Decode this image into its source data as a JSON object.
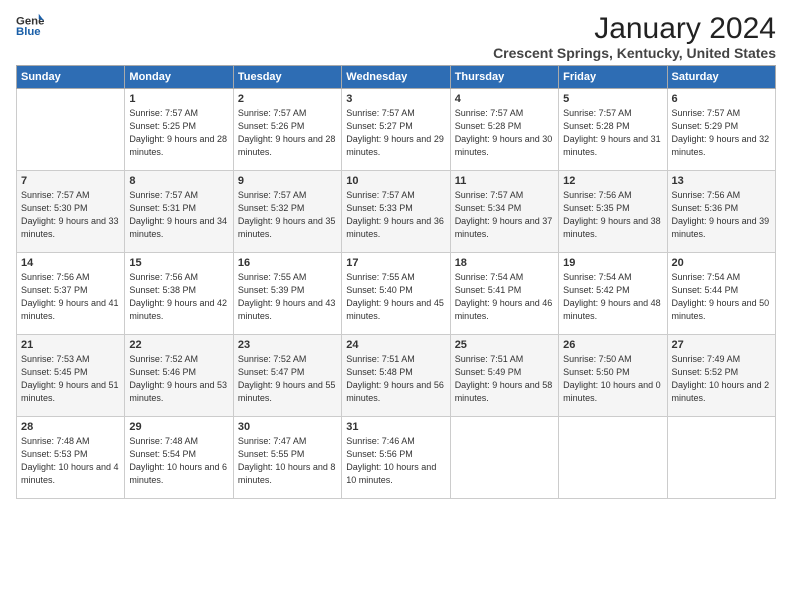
{
  "logo": {
    "line1": "General",
    "line2": "Blue"
  },
  "title": "January 2024",
  "location": "Crescent Springs, Kentucky, United States",
  "days_of_week": [
    "Sunday",
    "Monday",
    "Tuesday",
    "Wednesday",
    "Thursday",
    "Friday",
    "Saturday"
  ],
  "weeks": [
    [
      {
        "day": "",
        "sunrise": "",
        "sunset": "",
        "daylight": ""
      },
      {
        "day": "1",
        "sunrise": "Sunrise: 7:57 AM",
        "sunset": "Sunset: 5:25 PM",
        "daylight": "Daylight: 9 hours and 28 minutes."
      },
      {
        "day": "2",
        "sunrise": "Sunrise: 7:57 AM",
        "sunset": "Sunset: 5:26 PM",
        "daylight": "Daylight: 9 hours and 28 minutes."
      },
      {
        "day": "3",
        "sunrise": "Sunrise: 7:57 AM",
        "sunset": "Sunset: 5:27 PM",
        "daylight": "Daylight: 9 hours and 29 minutes."
      },
      {
        "day": "4",
        "sunrise": "Sunrise: 7:57 AM",
        "sunset": "Sunset: 5:28 PM",
        "daylight": "Daylight: 9 hours and 30 minutes."
      },
      {
        "day": "5",
        "sunrise": "Sunrise: 7:57 AM",
        "sunset": "Sunset: 5:28 PM",
        "daylight": "Daylight: 9 hours and 31 minutes."
      },
      {
        "day": "6",
        "sunrise": "Sunrise: 7:57 AM",
        "sunset": "Sunset: 5:29 PM",
        "daylight": "Daylight: 9 hours and 32 minutes."
      }
    ],
    [
      {
        "day": "7",
        "sunrise": "Sunrise: 7:57 AM",
        "sunset": "Sunset: 5:30 PM",
        "daylight": "Daylight: 9 hours and 33 minutes."
      },
      {
        "day": "8",
        "sunrise": "Sunrise: 7:57 AM",
        "sunset": "Sunset: 5:31 PM",
        "daylight": "Daylight: 9 hours and 34 minutes."
      },
      {
        "day": "9",
        "sunrise": "Sunrise: 7:57 AM",
        "sunset": "Sunset: 5:32 PM",
        "daylight": "Daylight: 9 hours and 35 minutes."
      },
      {
        "day": "10",
        "sunrise": "Sunrise: 7:57 AM",
        "sunset": "Sunset: 5:33 PM",
        "daylight": "Daylight: 9 hours and 36 minutes."
      },
      {
        "day": "11",
        "sunrise": "Sunrise: 7:57 AM",
        "sunset": "Sunset: 5:34 PM",
        "daylight": "Daylight: 9 hours and 37 minutes."
      },
      {
        "day": "12",
        "sunrise": "Sunrise: 7:56 AM",
        "sunset": "Sunset: 5:35 PM",
        "daylight": "Daylight: 9 hours and 38 minutes."
      },
      {
        "day": "13",
        "sunrise": "Sunrise: 7:56 AM",
        "sunset": "Sunset: 5:36 PM",
        "daylight": "Daylight: 9 hours and 39 minutes."
      }
    ],
    [
      {
        "day": "14",
        "sunrise": "Sunrise: 7:56 AM",
        "sunset": "Sunset: 5:37 PM",
        "daylight": "Daylight: 9 hours and 41 minutes."
      },
      {
        "day": "15",
        "sunrise": "Sunrise: 7:56 AM",
        "sunset": "Sunset: 5:38 PM",
        "daylight": "Daylight: 9 hours and 42 minutes."
      },
      {
        "day": "16",
        "sunrise": "Sunrise: 7:55 AM",
        "sunset": "Sunset: 5:39 PM",
        "daylight": "Daylight: 9 hours and 43 minutes."
      },
      {
        "day": "17",
        "sunrise": "Sunrise: 7:55 AM",
        "sunset": "Sunset: 5:40 PM",
        "daylight": "Daylight: 9 hours and 45 minutes."
      },
      {
        "day": "18",
        "sunrise": "Sunrise: 7:54 AM",
        "sunset": "Sunset: 5:41 PM",
        "daylight": "Daylight: 9 hours and 46 minutes."
      },
      {
        "day": "19",
        "sunrise": "Sunrise: 7:54 AM",
        "sunset": "Sunset: 5:42 PM",
        "daylight": "Daylight: 9 hours and 48 minutes."
      },
      {
        "day": "20",
        "sunrise": "Sunrise: 7:54 AM",
        "sunset": "Sunset: 5:44 PM",
        "daylight": "Daylight: 9 hours and 50 minutes."
      }
    ],
    [
      {
        "day": "21",
        "sunrise": "Sunrise: 7:53 AM",
        "sunset": "Sunset: 5:45 PM",
        "daylight": "Daylight: 9 hours and 51 minutes."
      },
      {
        "day": "22",
        "sunrise": "Sunrise: 7:52 AM",
        "sunset": "Sunset: 5:46 PM",
        "daylight": "Daylight: 9 hours and 53 minutes."
      },
      {
        "day": "23",
        "sunrise": "Sunrise: 7:52 AM",
        "sunset": "Sunset: 5:47 PM",
        "daylight": "Daylight: 9 hours and 55 minutes."
      },
      {
        "day": "24",
        "sunrise": "Sunrise: 7:51 AM",
        "sunset": "Sunset: 5:48 PM",
        "daylight": "Daylight: 9 hours and 56 minutes."
      },
      {
        "day": "25",
        "sunrise": "Sunrise: 7:51 AM",
        "sunset": "Sunset: 5:49 PM",
        "daylight": "Daylight: 9 hours and 58 minutes."
      },
      {
        "day": "26",
        "sunrise": "Sunrise: 7:50 AM",
        "sunset": "Sunset: 5:50 PM",
        "daylight": "Daylight: 10 hours and 0 minutes."
      },
      {
        "day": "27",
        "sunrise": "Sunrise: 7:49 AM",
        "sunset": "Sunset: 5:52 PM",
        "daylight": "Daylight: 10 hours and 2 minutes."
      }
    ],
    [
      {
        "day": "28",
        "sunrise": "Sunrise: 7:48 AM",
        "sunset": "Sunset: 5:53 PM",
        "daylight": "Daylight: 10 hours and 4 minutes."
      },
      {
        "day": "29",
        "sunrise": "Sunrise: 7:48 AM",
        "sunset": "Sunset: 5:54 PM",
        "daylight": "Daylight: 10 hours and 6 minutes."
      },
      {
        "day": "30",
        "sunrise": "Sunrise: 7:47 AM",
        "sunset": "Sunset: 5:55 PM",
        "daylight": "Daylight: 10 hours and 8 minutes."
      },
      {
        "day": "31",
        "sunrise": "Sunrise: 7:46 AM",
        "sunset": "Sunset: 5:56 PM",
        "daylight": "Daylight: 10 hours and 10 minutes."
      },
      {
        "day": "",
        "sunrise": "",
        "sunset": "",
        "daylight": ""
      },
      {
        "day": "",
        "sunrise": "",
        "sunset": "",
        "daylight": ""
      },
      {
        "day": "",
        "sunrise": "",
        "sunset": "",
        "daylight": ""
      }
    ]
  ]
}
